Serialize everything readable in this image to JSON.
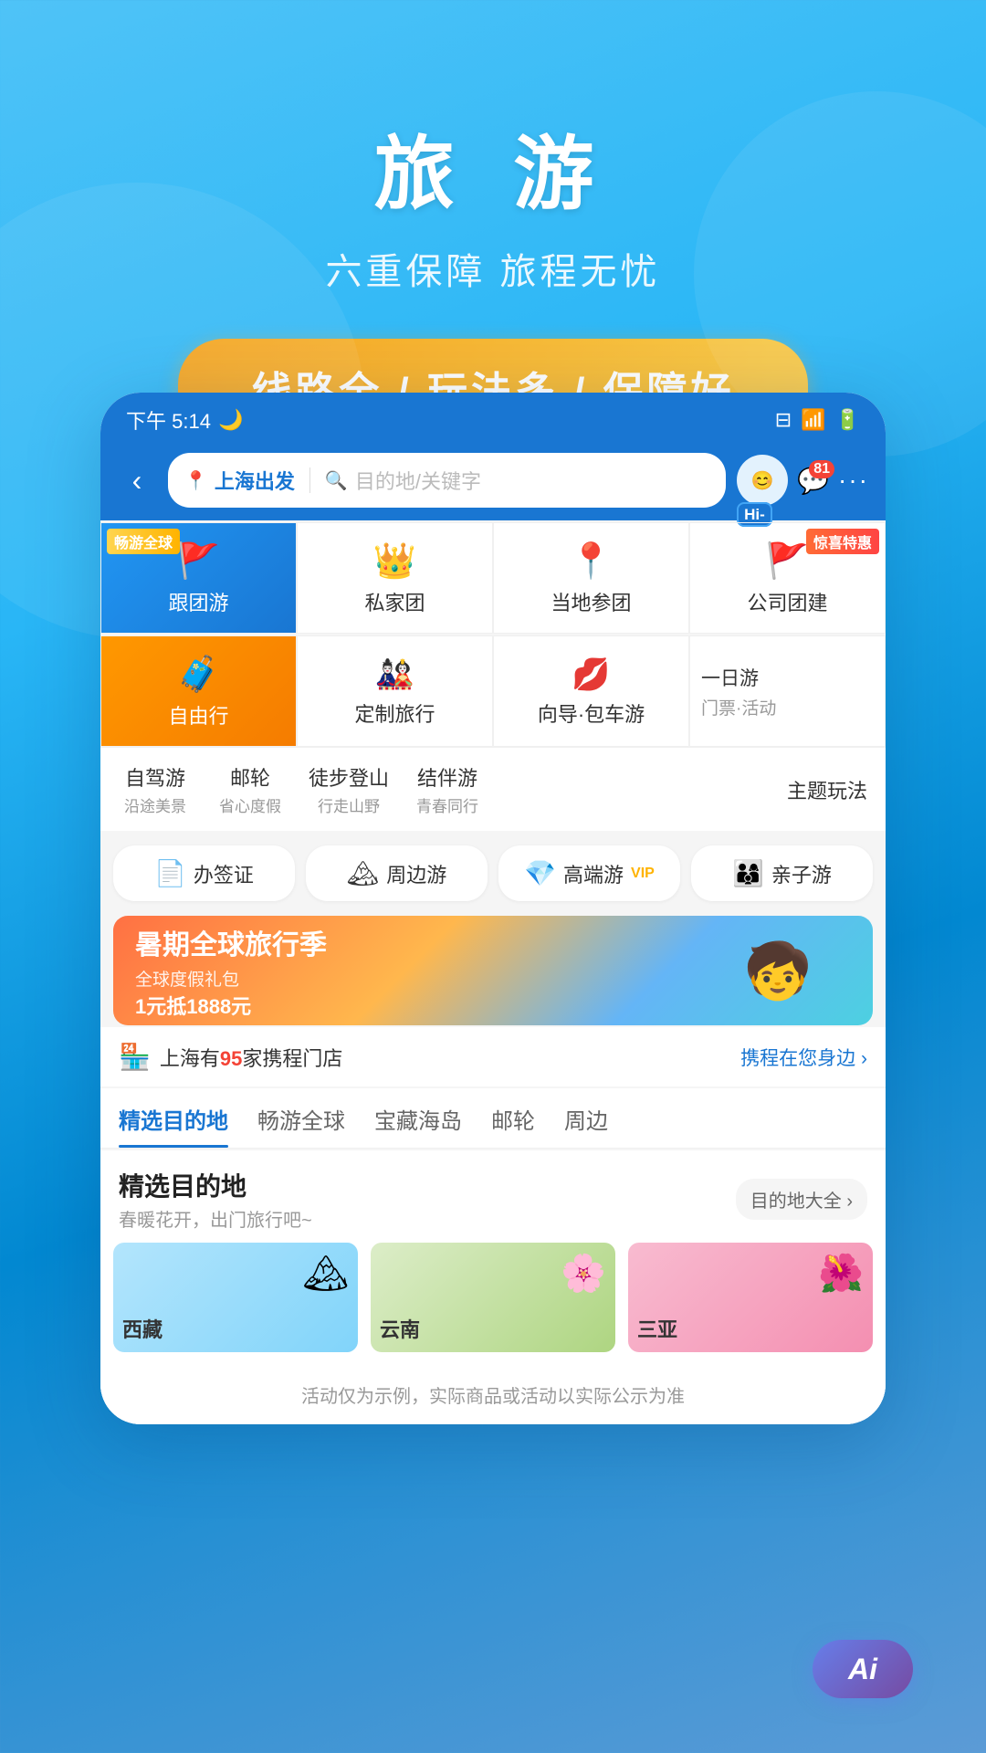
{
  "hero": {
    "title": "旅 游",
    "subtitle": "六重保障 旅程无忧",
    "badge": "线路全 / 玩法多 / 保障好"
  },
  "app": {
    "statusBar": {
      "time": "下午 5:14",
      "moonIcon": "🌙"
    },
    "navBar": {
      "backIcon": "‹",
      "fromCity": "上海出发",
      "searchPlaceholder": "目的地/关键字",
      "hiBadge": "Hi-",
      "notificationCount": "81",
      "moreIcon": "···"
    },
    "categories": {
      "row1": [
        {
          "id": "group-tour",
          "label": "跟团游",
          "icon": "🚩",
          "tag": "畅游全球",
          "tagPos": "left",
          "featured": "blue"
        },
        {
          "id": "private-tour",
          "label": "私家团",
          "icon": "👑",
          "tag": "",
          "featured": "none"
        },
        {
          "id": "local-tour",
          "label": "当地参团",
          "icon": "📍",
          "tag": "",
          "featured": "none"
        },
        {
          "id": "company-tour",
          "label": "公司团建",
          "icon": "🚩",
          "tag": "惊喜特惠",
          "tagPos": "right",
          "featured": "none"
        }
      ],
      "row2": [
        {
          "id": "free-travel",
          "label": "自由行",
          "icon": "🧳",
          "tag": "",
          "featured": "orange"
        },
        {
          "id": "custom-travel",
          "label": "定制旅行",
          "icon": "🎎",
          "tag": "",
          "featured": "none"
        },
        {
          "id": "guide-car",
          "label": "向导·包车游",
          "icon": "💋",
          "tag": "",
          "featured": "none"
        },
        {
          "id": "oneday-tour",
          "label": "一日游",
          "sublabel": "门票·活动",
          "icon": "",
          "tag": "",
          "featured": "none"
        }
      ],
      "row3": [
        {
          "id": "self-drive",
          "label": "自驾游",
          "sub": "沿途美景"
        },
        {
          "id": "cruise",
          "label": "邮轮",
          "sub": "省心度假"
        },
        {
          "id": "hiking",
          "label": "徒步登山",
          "sub": "行走山野"
        },
        {
          "id": "companion",
          "label": "结伴游",
          "sub": "青春同行"
        },
        {
          "id": "theme",
          "label": "主题玩法",
          "sub": ""
        }
      ]
    },
    "services": [
      {
        "id": "visa",
        "label": "办签证",
        "icon": "📄"
      },
      {
        "id": "nearby",
        "label": "周边游",
        "icon": "🏔"
      },
      {
        "id": "luxury",
        "label": "高端游",
        "icon": "💎"
      },
      {
        "id": "family",
        "label": "亲子游",
        "icon": "👨‍👩‍👦"
      }
    ],
    "banner": {
      "title": "暑期全球旅行季",
      "sub": "全球度假礼包",
      "promo": "1元抵1888元",
      "imageEmoji": "🧒"
    },
    "storeInfo": {
      "icon": "🏪",
      "text1": "上海有",
      "highlight": "95",
      "text2": "家携程门店",
      "link": "携程在您身边 ›"
    },
    "tabs": [
      {
        "id": "selected",
        "label": "精选目的地",
        "active": true
      },
      {
        "id": "global",
        "label": "畅游全球",
        "active": false
      },
      {
        "id": "island",
        "label": "宝藏海岛",
        "active": false
      },
      {
        "id": "cruise2",
        "label": "邮轮",
        "active": false
      },
      {
        "id": "nearby2",
        "label": "周边",
        "active": false
      }
    ],
    "featuredSection": {
      "title": "精选目的地",
      "subtitle": "春暖花开，出门旅行吧~",
      "linkLabel": "目的地大全 ›"
    },
    "disclaimer": "活动仅为示例，实际商品或活动以实际公示为准"
  },
  "ai": {
    "label": "Ai"
  }
}
